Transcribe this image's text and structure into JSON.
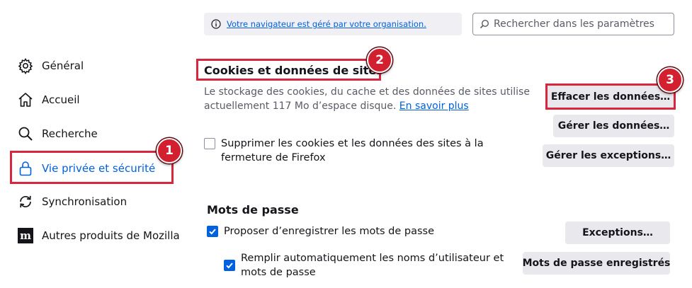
{
  "top": {
    "notice_text": "Votre navigateur est géré par votre organisation.",
    "search_placeholder": "Rechercher dans les paramètres"
  },
  "sidebar": {
    "items": [
      {
        "label": "Général",
        "icon": "gear-icon",
        "active": false
      },
      {
        "label": "Accueil",
        "icon": "home-icon",
        "active": false
      },
      {
        "label": "Recherche",
        "icon": "search-icon",
        "active": false
      },
      {
        "label": "Vie privée et sécurité",
        "icon": "lock-icon",
        "active": true
      },
      {
        "label": "Synchronisation",
        "icon": "sync-icon",
        "active": false
      },
      {
        "label": "Autres produits de Mozilla",
        "icon": "mozilla-icon",
        "active": false
      }
    ]
  },
  "cookies": {
    "heading": "Cookies et données de sites",
    "description": "Le stockage des cookies, du cache et des données de sites utilise actuellement 117 Mo d’espace disque.",
    "learn_more": "En savoir plus",
    "clear_button": "Effacer les données…",
    "manage_button": "Gérer les données…",
    "exceptions_button": "Gérer les exceptions…",
    "delete_on_close_label": "Supprimer les cookies et les données des sites à la fermeture de Firefox",
    "delete_on_close_checked": false
  },
  "passwords": {
    "heading": "Mots de passe",
    "offer_save_label": "Proposer d’enregistrer les mots de passe",
    "offer_save_checked": true,
    "autofill_label": "Remplir automatiquement les noms d’utilisateur et mots de passe",
    "autofill_checked": true,
    "exceptions_button": "Exceptions…",
    "saved_button": "Mots de passe enregistrés"
  },
  "annotations": {
    "markers": [
      "1",
      "2",
      "3"
    ],
    "color": "#d32030"
  },
  "colors": {
    "accent": "#0061e0",
    "highlight": "#d7263d"
  }
}
